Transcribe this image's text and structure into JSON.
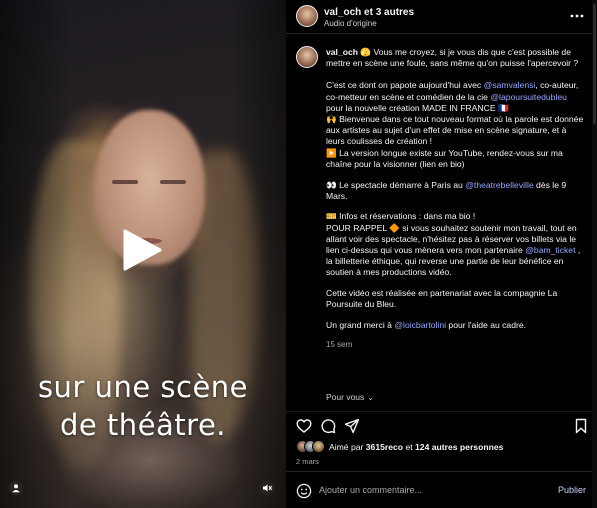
{
  "video": {
    "overlay_line1": "sur une scène",
    "overlay_line2": "de théâtre.",
    "play_icon": "play-icon",
    "user_icon": "user-icon",
    "mute_icon": "speaker-muted-icon"
  },
  "header": {
    "author": "val_och",
    "coauthors": " et 3 autres",
    "audio": "Audio d'origine",
    "more_icon": "more-horizontal-icon"
  },
  "caption": {
    "author": "val_och",
    "p1": " 🫣 Vous me croyez, si je vous dis que c'est possible de mettre en scène une foule, sans même qu'on puisse l'apercevoir ?",
    "p2_a": "C'est ce dont on papote aujourd'hui avec ",
    "p2_mention1": "@samvalensi",
    "p2_b": ", co-auteur, co-metteur en scène et comédien de la cie ",
    "p2_mention2": "@lapoursuitedubleu",
    "p2_c": " pour la nouvelle création MADE IN FRANCE 🇫🇷",
    "p2_d": "🙌 Bienvenue dans ce tout nouveau format où la parole est donnée aux artistes au sujet d'un effet de mise en scène signature, et à leurs coulisses de création !",
    "p2_e": "▶️ La version longue existe sur YouTube, rendez-vous sur ma chaîne pour la visionner (lien en bio)",
    "p3_a": "👀 Le spectacle démarre à Paris au ",
    "p3_mention": "@theatrebelleville",
    "p3_b": " dès le 9 Mars.",
    "p4_a": "🎫 Infos et réservations : dans ma bio !",
    "p4_b": "POUR RAPPEL 🔶 si vous souhaitez soutenir mon travail, tout en allant voir des spectacle, n'hésitez pas à réserver vos billets via le lien ci-dessus qui vous mènera vers mon partenaire ",
    "p4_mention": "@bam_ticket",
    "p4_c": " , la billetterie éthique, qui reverse une partie de leur bénéfice en soutien à mes productions vidéo.",
    "p5": "Cette vidéo est réalisée en partenariat avec la compagnie La Poursuite du Bleu.",
    "p6_a": "Un grand merci à ",
    "p6_mention": "@loicbartolini",
    "p6_b": " pour l'aide au cadre.",
    "time_ago": "15 sem",
    "replies": "Pour vous",
    "replies_icon": "chevron-down-icon"
  },
  "actions": {
    "like_icon": "heart-icon",
    "comment_icon": "comment-icon",
    "share_icon": "send-icon",
    "save_icon": "bookmark-icon"
  },
  "likes": {
    "prefix": "Aimé par ",
    "user": "3615reco",
    "middle": " et ",
    "others": "124 autres personnes"
  },
  "post_date": "2 mars",
  "comment": {
    "placeholder": "Ajouter un commentaire...",
    "publish": "Publier",
    "emoji_icon": "emoji-icon"
  }
}
